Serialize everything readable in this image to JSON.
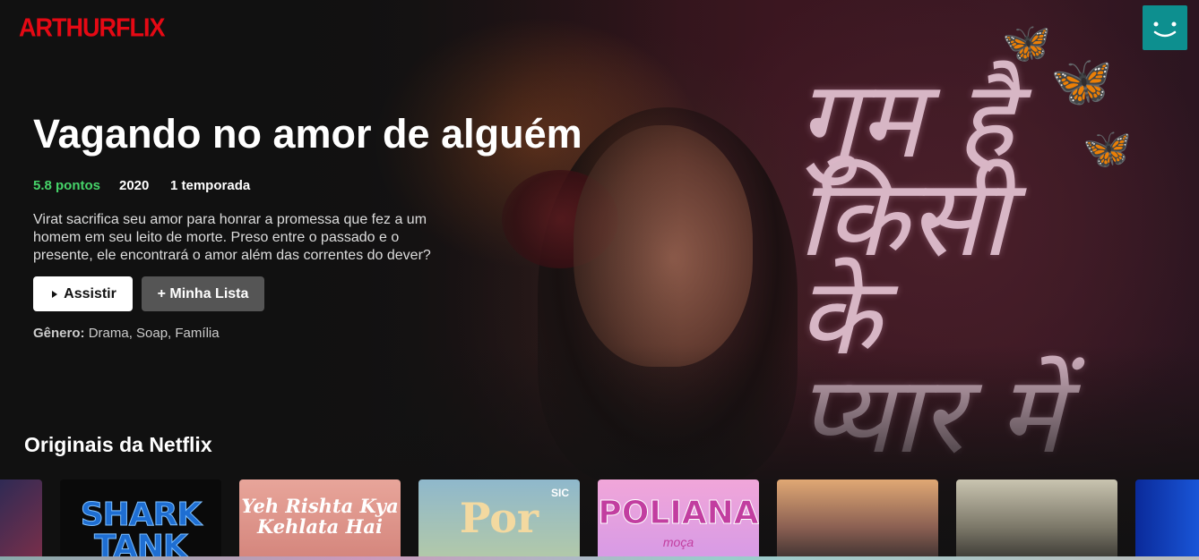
{
  "app": {
    "logo": "ARTHURFLIX",
    "accent": "#e50914"
  },
  "profile": {
    "icon": "smiley-avatar-icon",
    "color": "#0d8f8f"
  },
  "hero": {
    "title": "Vagando no amor de alguém",
    "points": "5.8 pontos",
    "year": "2020",
    "seasons": "1 temporada",
    "description": "Virat sacrifica seu amor para honrar a promessa que fez a um homem em seu leito de morte. Preso entre o passado e o presente, ele encontrará o amor além das correntes do dever?",
    "play_label": "Assistir",
    "play_icon": "play-triangle-icon",
    "list_label": "+ Minha Lista",
    "genre_label": "Gênero:",
    "genres": "Drama, Soap, Família",
    "poster_title": "गुम है किसी के प्यार में",
    "points_color": "#46d369"
  },
  "row": {
    "title": "Originais da Netflix",
    "cards": [
      {
        "text": ""
      },
      {
        "text": "SHARK TANK"
      },
      {
        "text": "Yeh Rishta Kya Kehlata Hai"
      },
      {
        "text": "Por",
        "badge": "SIC"
      },
      {
        "text": "POLIANA",
        "subtitle": "moça"
      },
      {
        "text": ""
      },
      {
        "text": ""
      },
      {
        "text": ""
      }
    ]
  }
}
